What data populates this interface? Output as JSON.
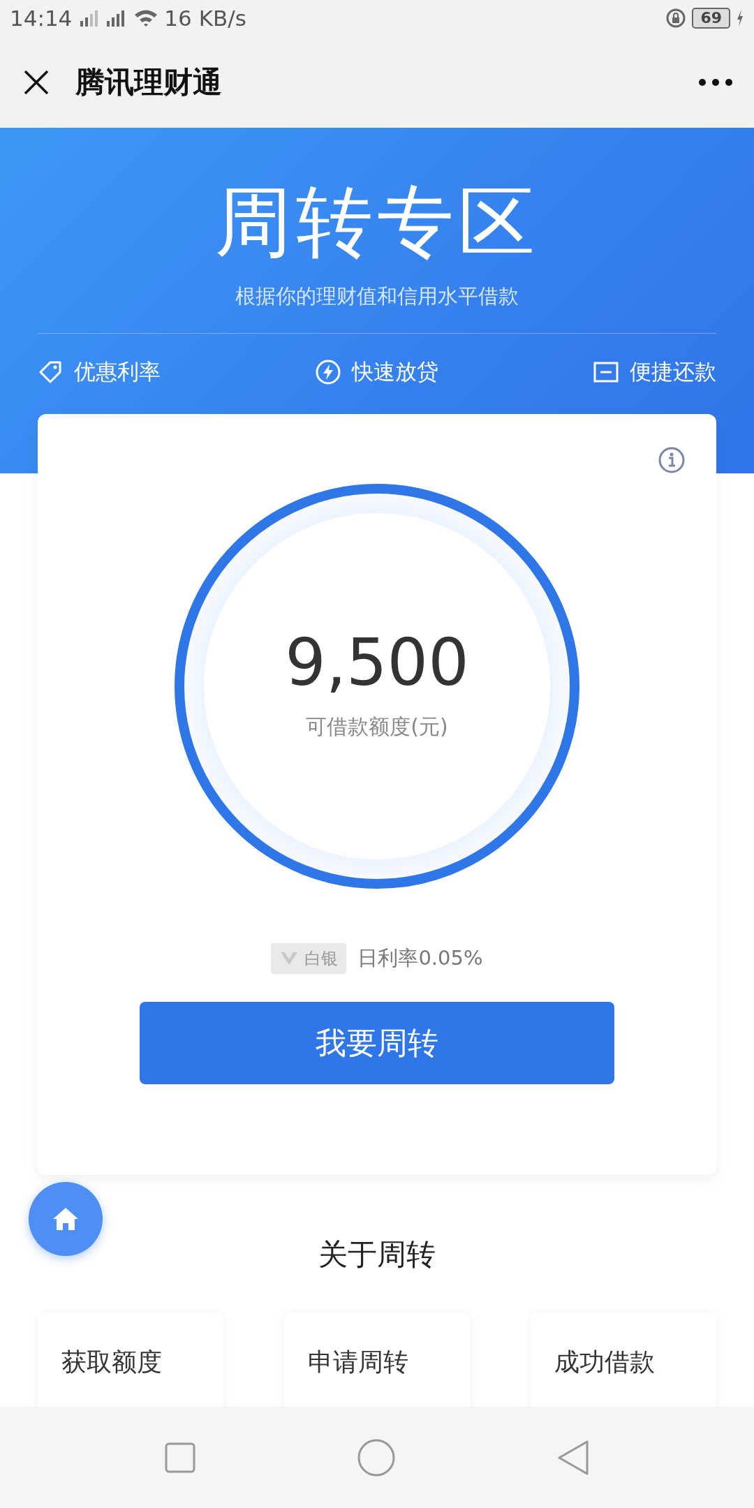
{
  "status_bar": {
    "time": "14:14",
    "net_speed": "16 KB/s",
    "battery": "69"
  },
  "header": {
    "title": "腾讯理财通"
  },
  "hero": {
    "title": "周转专区",
    "subtitle": "根据你的理财值和信用水平借款",
    "features": [
      {
        "kind": "tag",
        "label": "优惠利率"
      },
      {
        "kind": "bolt",
        "label": "快速放贷"
      },
      {
        "kind": "card",
        "label": "便捷还款"
      }
    ]
  },
  "loan_card": {
    "amount": "9,500",
    "amount_label": "可借款额度(元)",
    "tier": "白银",
    "rate": "日利率0.05%",
    "button": "我要周转"
  },
  "about": {
    "title": "关于周转",
    "steps": [
      {
        "title": "获取额度"
      },
      {
        "title": "申请周转"
      },
      {
        "title": "成功借款"
      }
    ]
  }
}
